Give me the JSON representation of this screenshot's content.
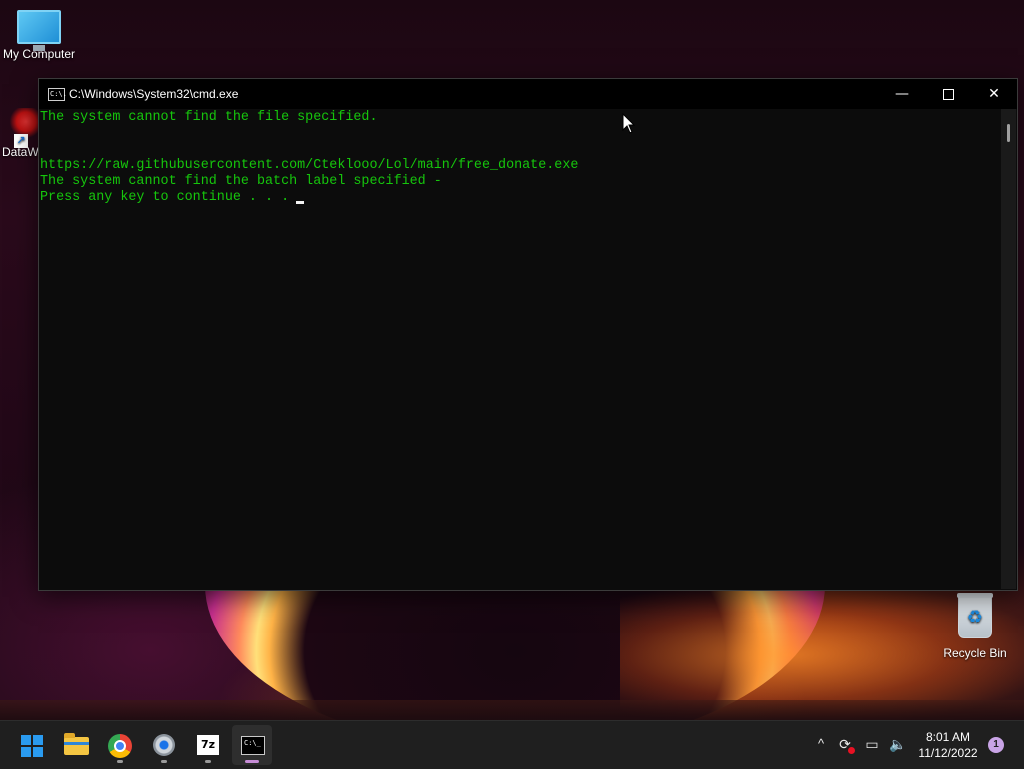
{
  "desktop": {
    "icons": [
      {
        "label": "My Computer",
        "icon": "monitor-icon"
      },
      {
        "label": "DataW",
        "icon": "datawrapper-icon"
      },
      {
        "label": "Recycle Bin",
        "icon": "recycle-bin-icon"
      }
    ]
  },
  "window": {
    "title": "C:\\Windows\\System32\\cmd.exe",
    "title_icon_text": "C:\\.",
    "controls": {
      "minimize": "—",
      "maximize": "",
      "close": "✕"
    },
    "console_lines": [
      "The system cannot find the file specified.",
      "https://raw.githubusercontent.com/Cteklooo/Lol/main/free_donate.exe",
      "The system cannot find the batch label specified -",
      "Press any key to continue . . ."
    ],
    "text_color": "#16c60c",
    "background_color": "#0c0c0c"
  },
  "taskbar": {
    "apps": [
      {
        "name": "Start",
        "icon": "windows-logo-icon"
      },
      {
        "name": "File Explorer",
        "icon": "folder-icon"
      },
      {
        "name": "Google Chrome",
        "icon": "chrome-icon"
      },
      {
        "name": "Settings",
        "icon": "gear-icon"
      },
      {
        "name": "7-Zip",
        "icon": "7zip-icon",
        "text": "7z"
      },
      {
        "name": "Command Prompt",
        "icon": "terminal-icon",
        "text": "C:\\_"
      }
    ],
    "tray": {
      "chevron": "^",
      "sync": "⟳",
      "network": "▭",
      "volume": "🔈",
      "time": "8:01 AM",
      "date": "11/12/2022",
      "notifications": "1"
    }
  }
}
